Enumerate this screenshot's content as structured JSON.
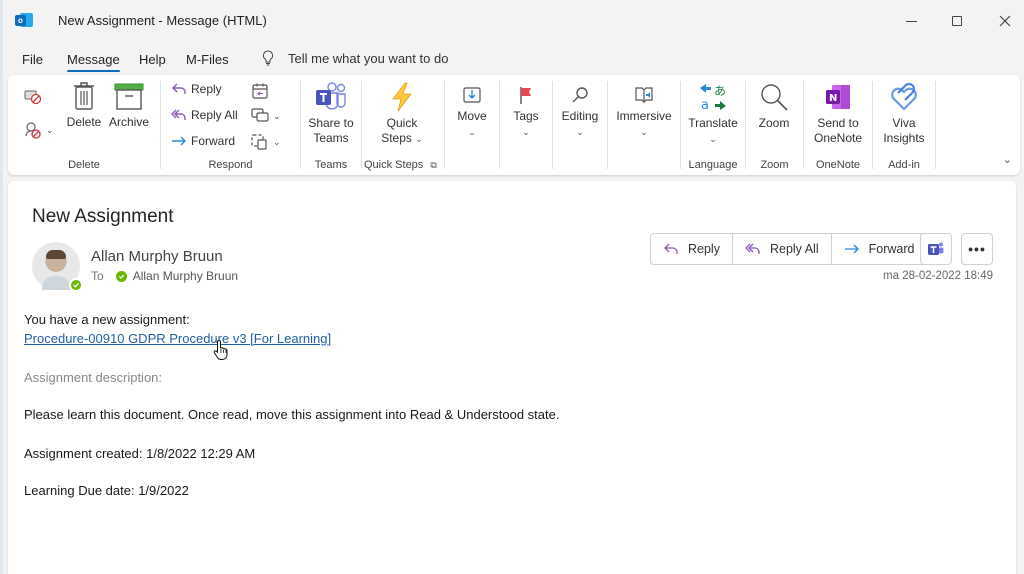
{
  "window": {
    "title": "New Assignment  -  Message (HTML)",
    "app_icon": "outlook-icon",
    "controls": [
      "minimize",
      "maximize",
      "close"
    ]
  },
  "menu": {
    "tabs": [
      {
        "label": "File",
        "active": false
      },
      {
        "label": "Message",
        "active": true
      },
      {
        "label": "Help",
        "active": false
      },
      {
        "label": "M-Files",
        "active": false
      }
    ],
    "tell_me": "Tell me what you want to do"
  },
  "ribbon": {
    "groups": {
      "delete": {
        "label": "Delete",
        "delete": "Delete",
        "archive": "Archive"
      },
      "respond": {
        "label": "Respond",
        "reply": "Reply",
        "reply_all": "Reply All",
        "forward": "Forward"
      },
      "teams": {
        "label": "Teams",
        "share": "Share to Teams"
      },
      "quick_steps": {
        "label": "Quick Steps",
        "button": "Quick Steps"
      },
      "move": {
        "button": "Move"
      },
      "tags": {
        "button": "Tags"
      },
      "editing": {
        "button": "Editing"
      },
      "immersive": {
        "button": "Immersive"
      },
      "language": {
        "label": "Language",
        "button": "Translate"
      },
      "zoom": {
        "label": "Zoom",
        "button": "Zoom"
      },
      "onenote": {
        "label": "OneNote",
        "button": "Send to OneNote"
      },
      "addin": {
        "label": "Add-in",
        "button": "Viva Insights"
      }
    }
  },
  "message": {
    "subject": "New Assignment",
    "sender": "Allan Murphy Bruun",
    "to_label": "To",
    "recipient": "Allan Murphy Bruun",
    "date": "ma 28-02-2022 18:49",
    "actions": {
      "reply": "Reply",
      "reply_all": "Reply All",
      "forward": "Forward",
      "more": "•••"
    },
    "body": {
      "intro": "You have a new assignment:",
      "link": "Procedure-00910 GDPR Procedure v3 [For Learning]",
      "desc_label": "Assignment description:",
      "description": "Please learn this document. Once read, move this assignment into Read & Understood state.",
      "created": "Assignment created: 1/8/2022 12:29 AM",
      "due": "Learning Due date: 1/9/2022"
    }
  },
  "colors": {
    "accent": "#0f6cbd",
    "link": "#1f5ea8",
    "presence": "#6bb700",
    "reply_icon": "#8a5bb8",
    "forward_icon": "#2b88d8"
  }
}
